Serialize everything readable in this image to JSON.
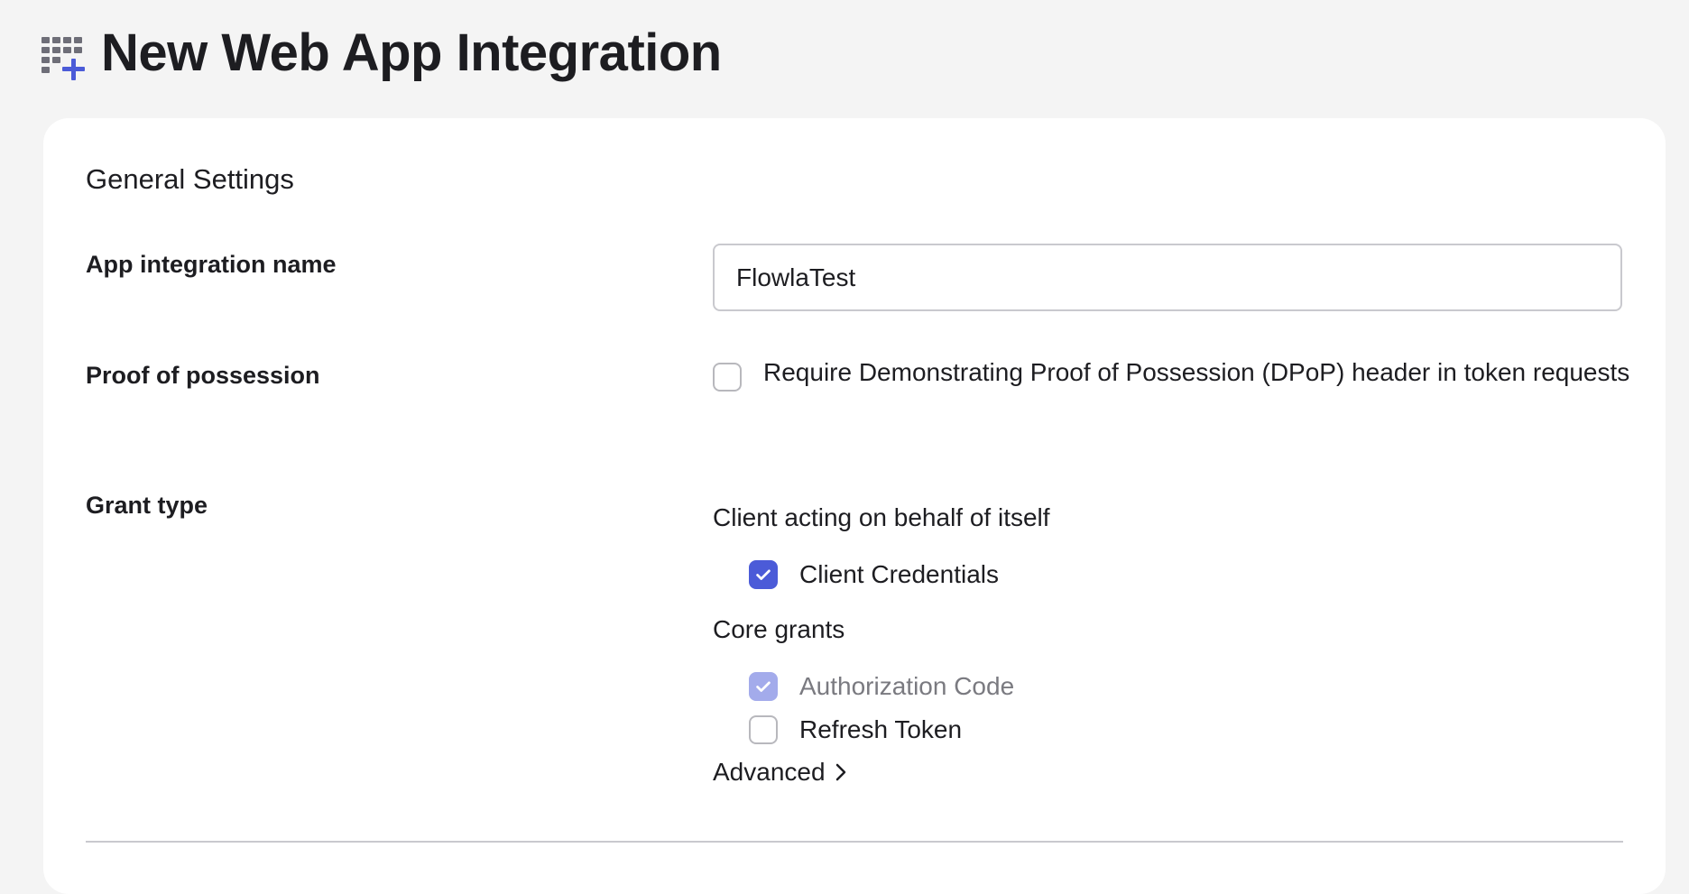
{
  "header": {
    "title": "New Web App Integration",
    "icon": "add-app-grid-icon",
    "icon_colors": {
      "grid": "#6e6e78",
      "plus": "#4b5bd8"
    }
  },
  "general_settings": {
    "title": "General Settings",
    "app_name": {
      "label": "App integration name",
      "value": "FlowlaTest"
    },
    "proof_of_possession": {
      "label": "Proof of possession",
      "option_text": "Require Demonstrating Proof of Possession (DPoP) header in token requests",
      "checked": false
    },
    "grant_type": {
      "label": "Grant type",
      "groups": [
        {
          "title": "Client acting on behalf of itself",
          "options": [
            {
              "label": "Client Credentials",
              "checked": true,
              "disabled": false
            }
          ]
        },
        {
          "title": "Core grants",
          "options": [
            {
              "label": "Authorization Code",
              "checked": true,
              "disabled": true
            },
            {
              "label": "Refresh Token",
              "checked": false,
              "disabled": false
            }
          ]
        }
      ],
      "advanced_label": "Advanced"
    }
  },
  "colors": {
    "accent": "#4b5bd8",
    "accent_disabled": "#a3abeb",
    "background": "#f4f4f4",
    "card": "#ffffff"
  }
}
